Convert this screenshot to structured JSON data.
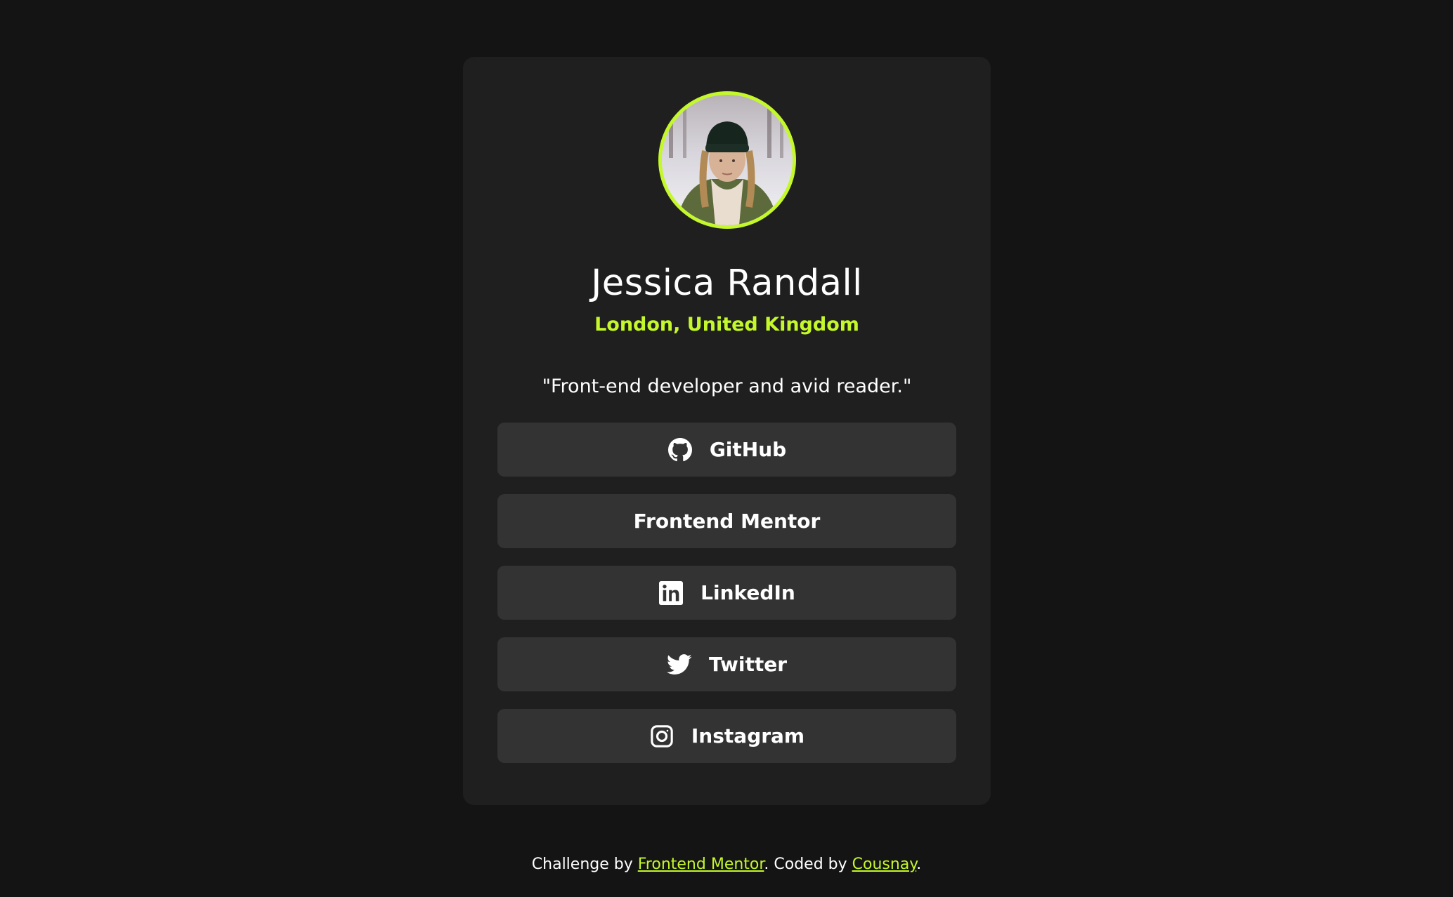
{
  "profile": {
    "name": "Jessica Randall",
    "location": "London, United Kingdom",
    "bio": "\"Front-end developer and avid reader.\""
  },
  "links": [
    {
      "label": "GitHub",
      "icon": "github-icon"
    },
    {
      "label": "Frontend Mentor",
      "icon": null
    },
    {
      "label": "LinkedIn",
      "icon": "linkedin-icon"
    },
    {
      "label": "Twitter",
      "icon": "twitter-icon"
    },
    {
      "label": "Instagram",
      "icon": "instagram-icon"
    }
  ],
  "footer": {
    "prefix": "Challenge by ",
    "challenge_link": "Frontend Mentor",
    "middle": ". Coded by ",
    "author_link": "Cousnay",
    "suffix": "."
  },
  "colors": {
    "background": "#141414",
    "card": "#1f1f1f",
    "button": "#333333",
    "accent": "#c4f82a",
    "text": "#ffffff"
  }
}
